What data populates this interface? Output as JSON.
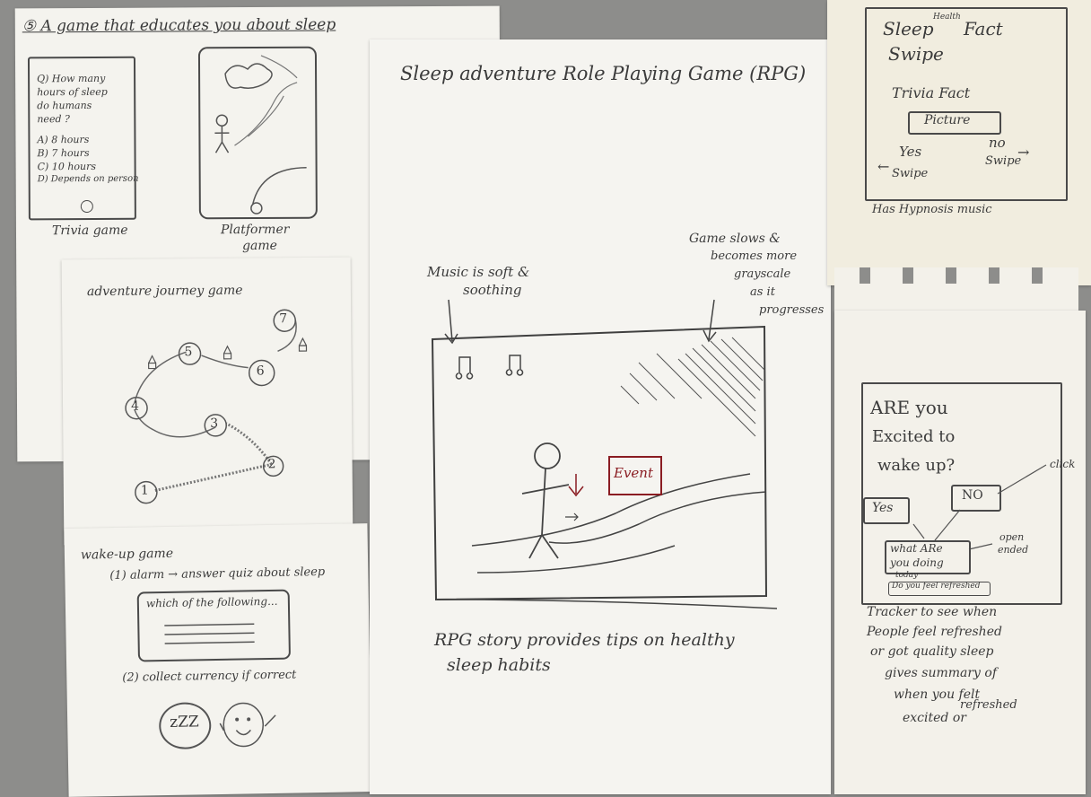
{
  "games_sheet": {
    "title": "⑤ A game that educates you about sleep",
    "trivia_question": [
      "Q) How many",
      "hours of sleep",
      "do humans",
      "need ?"
    ],
    "trivia_options": [
      "A) 8 hours",
      "B) 7 hours",
      "C) 10 hours",
      "D) Depends on person"
    ],
    "trivia_caption": "Trivia game",
    "platformer_caption": [
      "Platformer",
      "game"
    ]
  },
  "adventure_sheet": {
    "title": "adventure journey game",
    "nodes": [
      "1",
      "2",
      "3",
      "4",
      "5",
      "6",
      "7"
    ]
  },
  "wake_sheet": {
    "title": "wake-up game",
    "step1": "(1) alarm → answer quiz about sleep",
    "quiz_text": "which of the following...",
    "step2": "(2) collect currency if correct",
    "coin_text": "zZZ"
  },
  "rpg_sheet": {
    "title": "Sleep adventure Role Playing Game (RPG)",
    "music_note": [
      "Music is soft &",
      "soothing"
    ],
    "slow_note": [
      "Game slows &",
      "becomes more",
      "grayscale",
      "as it",
      "progresses"
    ],
    "event_label": "Event",
    "caption": [
      "RPG story provides tips on healthy",
      "sleep habits"
    ]
  },
  "swipe_sheet": {
    "title": [
      "Sleep",
      "Swipe"
    ],
    "superscript": "Health",
    "title_right": "Fact",
    "trivia_fact": "Trivia Fact",
    "picture_label": "Picture",
    "yes_label": "Yes",
    "yes_swipe": "Swipe",
    "no_label": "no",
    "no_swipe": "Swipe",
    "caption": "Has Hypnosis music"
  },
  "tracker_sheet": {
    "question": [
      "ARE you",
      "Excited to",
      "wake up?"
    ],
    "click_note": "click",
    "yes_label": "Yes",
    "no_label": "NO",
    "doing_label": [
      "what ARe",
      "you doing",
      "today"
    ],
    "open_note": [
      "open",
      "ended"
    ],
    "refreshed_label": "Do you feel refreshed",
    "caption": [
      "Tracker to see when",
      "People feel refreshed",
      "or got quality sleep",
      "gives summary of",
      "when you felt",
      "excited or",
      "refreshed"
    ]
  },
  "colors": {
    "paper": "#f4f3ee",
    "paper_warm": "#f1eddf",
    "ink": "#3b3b3b",
    "red_ink": "#8a1c22",
    "background": "#8d8d8b"
  }
}
